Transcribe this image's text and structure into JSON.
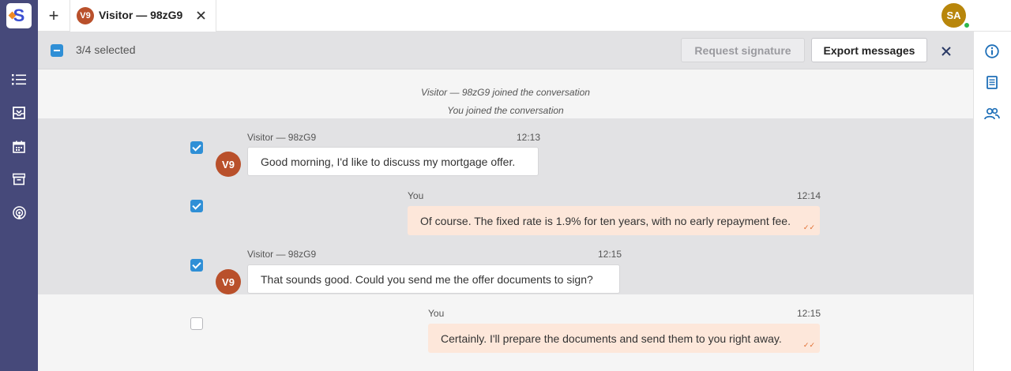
{
  "app": {
    "logo_letter": "S",
    "new_tab_label": "+",
    "user_initials": "SA"
  },
  "tab": {
    "avatar_initials": "V9",
    "title": "Visitor — 98zG9"
  },
  "selection": {
    "count_text": "3/4 selected",
    "request_signature_label": "Request signature",
    "export_messages_label": "Export messages"
  },
  "system_messages": [
    "Visitor — 98zG9 joined the conversation",
    "You joined the conversation"
  ],
  "messages": [
    {
      "sender": "Visitor — 98zG9",
      "time": "12:13",
      "text": "Good morning, I'd like to discuss my mortgage offer.",
      "avatar": "V9",
      "selected": true
    },
    {
      "sender": "You",
      "time": "12:14",
      "text": "Of course. The fixed rate is 1.9% for ten years, with no early repayment fee.",
      "selected": true
    },
    {
      "sender": "Visitor — 98zG9",
      "time": "12:15",
      "text": "That sounds good. Could you send me the offer documents to sign?",
      "avatar": "V9",
      "selected": true
    },
    {
      "sender": "You",
      "time": "12:15",
      "text": "Certainly. I'll prepare the documents and send them to you right away.",
      "selected": false
    }
  ],
  "colors": {
    "sidebar": "#46497a",
    "accent": "#2f8fd6",
    "visitor_avatar": "#b9502b",
    "outgoing_bubble": "#fde7da",
    "online": "#2db84d"
  },
  "icons": {
    "sidebar": [
      "list-icon",
      "inbox-icon",
      "calendar-icon",
      "archive-icon",
      "broadcast-icon"
    ],
    "right_rail": [
      "info-icon",
      "document-icon",
      "users-icon"
    ]
  }
}
